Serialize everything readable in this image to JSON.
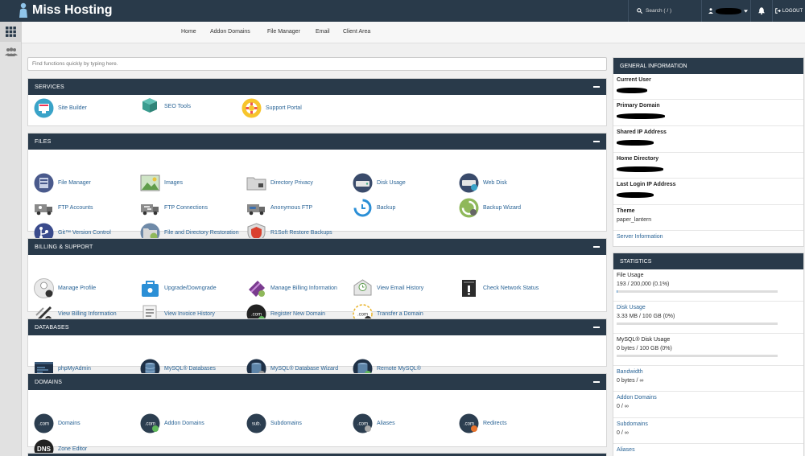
{
  "brand": {
    "name": "Miss Hosting"
  },
  "topbar": {
    "search": "Search ( / )",
    "logout": "LOGOUT"
  },
  "nav": [
    "Home",
    "Addon Domains",
    "File Manager",
    "Email",
    "Client Area"
  ],
  "search": {
    "placeholder": "Find functions quickly by typing here."
  },
  "sections": [
    {
      "title": "SERVICES",
      "items": [
        {
          "label": "Site Builder",
          "icon": "site-builder-icon"
        },
        {
          "label": "SEO Tools",
          "icon": "seo-tools-icon"
        },
        {
          "label": "Support Portal",
          "icon": "support-portal-icon"
        }
      ]
    },
    {
      "title": "FILES",
      "items": [
        {
          "label": "File Manager",
          "icon": "file-manager-icon"
        },
        {
          "label": "Images",
          "icon": "images-icon"
        },
        {
          "label": "Directory Privacy",
          "icon": "directory-privacy-icon"
        },
        {
          "label": "Disk Usage",
          "icon": "disk-usage-icon"
        },
        {
          "label": "Web Disk",
          "icon": "web-disk-icon"
        },
        {
          "label": "FTP Accounts",
          "icon": "ftp-accounts-icon"
        },
        {
          "label": "FTP Connections",
          "icon": "ftp-connections-icon"
        },
        {
          "label": "Anonymous FTP",
          "icon": "anonymous-ftp-icon"
        },
        {
          "label": "Backup",
          "icon": "backup-icon"
        },
        {
          "label": "Backup Wizard",
          "icon": "backup-wizard-icon"
        },
        {
          "label": "Git™ Version Control",
          "icon": "git-icon"
        },
        {
          "label": "File and Directory Restoration",
          "icon": "restoration-icon"
        },
        {
          "label": "R1Soft Restore Backups",
          "icon": "r1soft-icon"
        }
      ]
    },
    {
      "title": "BILLING & SUPPORT",
      "items": [
        {
          "label": "Manage Profile",
          "icon": "manage-profile-icon"
        },
        {
          "label": "Upgrade/Downgrade",
          "icon": "upgrade-icon"
        },
        {
          "label": "Manage Billing Information",
          "icon": "billing-card-icon"
        },
        {
          "label": "View Email History",
          "icon": "email-history-icon"
        },
        {
          "label": "Check Network Status",
          "icon": "network-status-icon"
        },
        {
          "label": "View Billing Information",
          "icon": "view-billing-icon"
        },
        {
          "label": "View Invoice History",
          "icon": "invoice-icon"
        },
        {
          "label": "Register New Domain",
          "icon": "register-domain-icon"
        },
        {
          "label": "Transfer a Domain",
          "icon": "transfer-domain-icon"
        }
      ]
    },
    {
      "title": "DATABASES",
      "items": [
        {
          "label": "phpMyAdmin",
          "icon": "phpmyadmin-icon"
        },
        {
          "label": "MySQL® Databases",
          "icon": "mysql-databases-icon"
        },
        {
          "label": "MySQL® Database Wizard",
          "icon": "mysql-wizard-icon"
        },
        {
          "label": "Remote MySQL®",
          "icon": "remote-mysql-icon"
        }
      ]
    },
    {
      "title": "DOMAINS",
      "items": [
        {
          "label": "Domains",
          "icon": "domains-icon"
        },
        {
          "label": "Addon Domains",
          "icon": "addon-domains-icon"
        },
        {
          "label": "Subdomains",
          "icon": "subdomains-icon"
        },
        {
          "label": "Aliases",
          "icon": "aliases-icon"
        },
        {
          "label": "Redirects",
          "icon": "redirects-icon"
        },
        {
          "label": "Zone Editor",
          "icon": "zone-editor-icon"
        }
      ]
    }
  ],
  "general": {
    "title": "GENERAL INFORMATION",
    "current_user": "Current User",
    "primary_domain": "Primary Domain",
    "shared_ip": "Shared IP Address",
    "home_directory": "Home Directory",
    "last_login_ip": "Last Login IP Address",
    "theme_label": "Theme",
    "theme_value": "paper_lantern",
    "server_information": "Server Information"
  },
  "statistics": {
    "title": "STATISTICS",
    "rows": [
      {
        "label": "File Usage",
        "value": "193 / 200,000   (0.1%)",
        "percent": 0.1
      },
      {
        "label": "Disk Usage",
        "value": "3.33 MB / 100 GB   (0%)",
        "percent": 0
      },
      {
        "label": "MySQL® Disk Usage",
        "value": "0 bytes / 100 GB   (0%)",
        "percent": 0
      },
      {
        "label": "Bandwidth",
        "value": "0 bytes / ∞"
      },
      {
        "label": "Addon Domains",
        "value": "0 / ∞"
      },
      {
        "label": "Subdomains",
        "value": "0 / ∞"
      },
      {
        "label": "Aliases",
        "value": ""
      }
    ]
  },
  "colors": {
    "header": "#293a4a",
    "link": "#2a6496",
    "accent": "#5a9bd4"
  }
}
